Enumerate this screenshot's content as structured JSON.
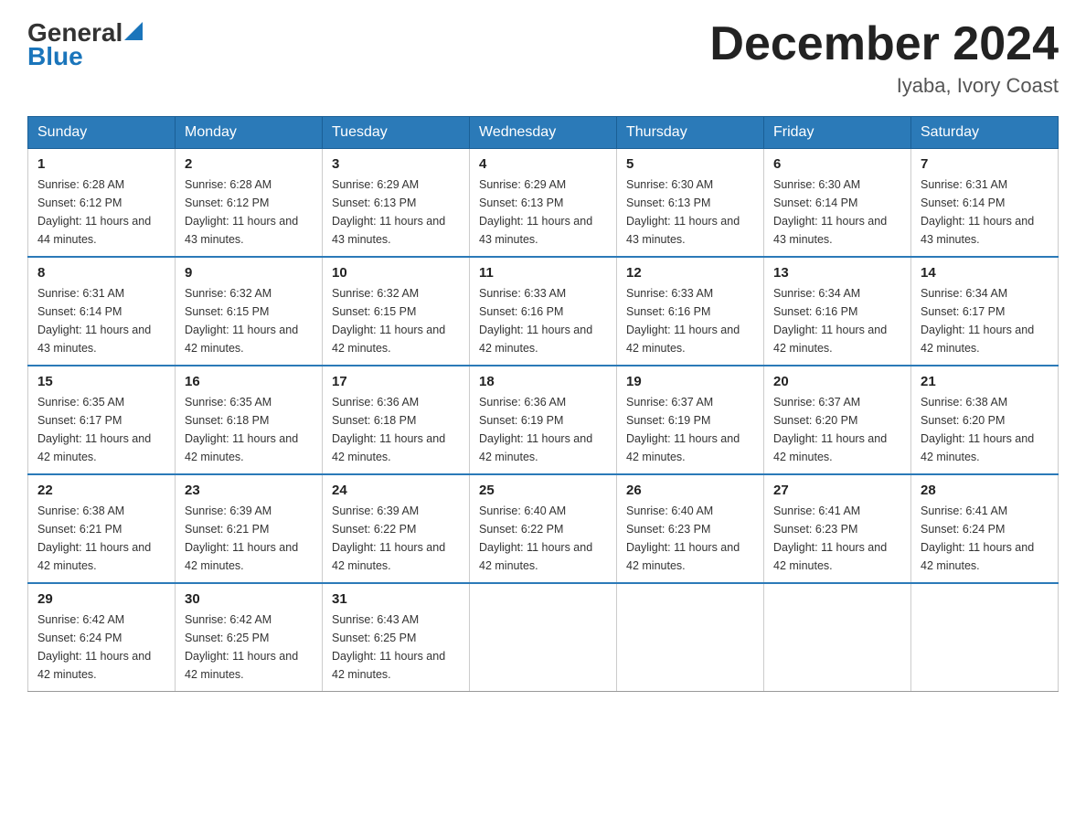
{
  "header": {
    "logo_general": "General",
    "logo_blue": "Blue",
    "month_title": "December 2024",
    "location": "Iyaba, Ivory Coast"
  },
  "days_of_week": [
    "Sunday",
    "Monday",
    "Tuesday",
    "Wednesday",
    "Thursday",
    "Friday",
    "Saturday"
  ],
  "weeks": [
    [
      {
        "day": "1",
        "sunrise": "6:28 AM",
        "sunset": "6:12 PM",
        "daylight": "11 hours and 44 minutes."
      },
      {
        "day": "2",
        "sunrise": "6:28 AM",
        "sunset": "6:12 PM",
        "daylight": "11 hours and 43 minutes."
      },
      {
        "day": "3",
        "sunrise": "6:29 AM",
        "sunset": "6:13 PM",
        "daylight": "11 hours and 43 minutes."
      },
      {
        "day": "4",
        "sunrise": "6:29 AM",
        "sunset": "6:13 PM",
        "daylight": "11 hours and 43 minutes."
      },
      {
        "day": "5",
        "sunrise": "6:30 AM",
        "sunset": "6:13 PM",
        "daylight": "11 hours and 43 minutes."
      },
      {
        "day": "6",
        "sunrise": "6:30 AM",
        "sunset": "6:14 PM",
        "daylight": "11 hours and 43 minutes."
      },
      {
        "day": "7",
        "sunrise": "6:31 AM",
        "sunset": "6:14 PM",
        "daylight": "11 hours and 43 minutes."
      }
    ],
    [
      {
        "day": "8",
        "sunrise": "6:31 AM",
        "sunset": "6:14 PM",
        "daylight": "11 hours and 43 minutes."
      },
      {
        "day": "9",
        "sunrise": "6:32 AM",
        "sunset": "6:15 PM",
        "daylight": "11 hours and 42 minutes."
      },
      {
        "day": "10",
        "sunrise": "6:32 AM",
        "sunset": "6:15 PM",
        "daylight": "11 hours and 42 minutes."
      },
      {
        "day": "11",
        "sunrise": "6:33 AM",
        "sunset": "6:16 PM",
        "daylight": "11 hours and 42 minutes."
      },
      {
        "day": "12",
        "sunrise": "6:33 AM",
        "sunset": "6:16 PM",
        "daylight": "11 hours and 42 minutes."
      },
      {
        "day": "13",
        "sunrise": "6:34 AM",
        "sunset": "6:16 PM",
        "daylight": "11 hours and 42 minutes."
      },
      {
        "day": "14",
        "sunrise": "6:34 AM",
        "sunset": "6:17 PM",
        "daylight": "11 hours and 42 minutes."
      }
    ],
    [
      {
        "day": "15",
        "sunrise": "6:35 AM",
        "sunset": "6:17 PM",
        "daylight": "11 hours and 42 minutes."
      },
      {
        "day": "16",
        "sunrise": "6:35 AM",
        "sunset": "6:18 PM",
        "daylight": "11 hours and 42 minutes."
      },
      {
        "day": "17",
        "sunrise": "6:36 AM",
        "sunset": "6:18 PM",
        "daylight": "11 hours and 42 minutes."
      },
      {
        "day": "18",
        "sunrise": "6:36 AM",
        "sunset": "6:19 PM",
        "daylight": "11 hours and 42 minutes."
      },
      {
        "day": "19",
        "sunrise": "6:37 AM",
        "sunset": "6:19 PM",
        "daylight": "11 hours and 42 minutes."
      },
      {
        "day": "20",
        "sunrise": "6:37 AM",
        "sunset": "6:20 PM",
        "daylight": "11 hours and 42 minutes."
      },
      {
        "day": "21",
        "sunrise": "6:38 AM",
        "sunset": "6:20 PM",
        "daylight": "11 hours and 42 minutes."
      }
    ],
    [
      {
        "day": "22",
        "sunrise": "6:38 AM",
        "sunset": "6:21 PM",
        "daylight": "11 hours and 42 minutes."
      },
      {
        "day": "23",
        "sunrise": "6:39 AM",
        "sunset": "6:21 PM",
        "daylight": "11 hours and 42 minutes."
      },
      {
        "day": "24",
        "sunrise": "6:39 AM",
        "sunset": "6:22 PM",
        "daylight": "11 hours and 42 minutes."
      },
      {
        "day": "25",
        "sunrise": "6:40 AM",
        "sunset": "6:22 PM",
        "daylight": "11 hours and 42 minutes."
      },
      {
        "day": "26",
        "sunrise": "6:40 AM",
        "sunset": "6:23 PM",
        "daylight": "11 hours and 42 minutes."
      },
      {
        "day": "27",
        "sunrise": "6:41 AM",
        "sunset": "6:23 PM",
        "daylight": "11 hours and 42 minutes."
      },
      {
        "day": "28",
        "sunrise": "6:41 AM",
        "sunset": "6:24 PM",
        "daylight": "11 hours and 42 minutes."
      }
    ],
    [
      {
        "day": "29",
        "sunrise": "6:42 AM",
        "sunset": "6:24 PM",
        "daylight": "11 hours and 42 minutes."
      },
      {
        "day": "30",
        "sunrise": "6:42 AM",
        "sunset": "6:25 PM",
        "daylight": "11 hours and 42 minutes."
      },
      {
        "day": "31",
        "sunrise": "6:43 AM",
        "sunset": "6:25 PM",
        "daylight": "11 hours and 42 minutes."
      },
      null,
      null,
      null,
      null
    ]
  ],
  "labels": {
    "sunrise_prefix": "Sunrise: ",
    "sunset_prefix": "Sunset: ",
    "daylight_prefix": "Daylight: "
  }
}
